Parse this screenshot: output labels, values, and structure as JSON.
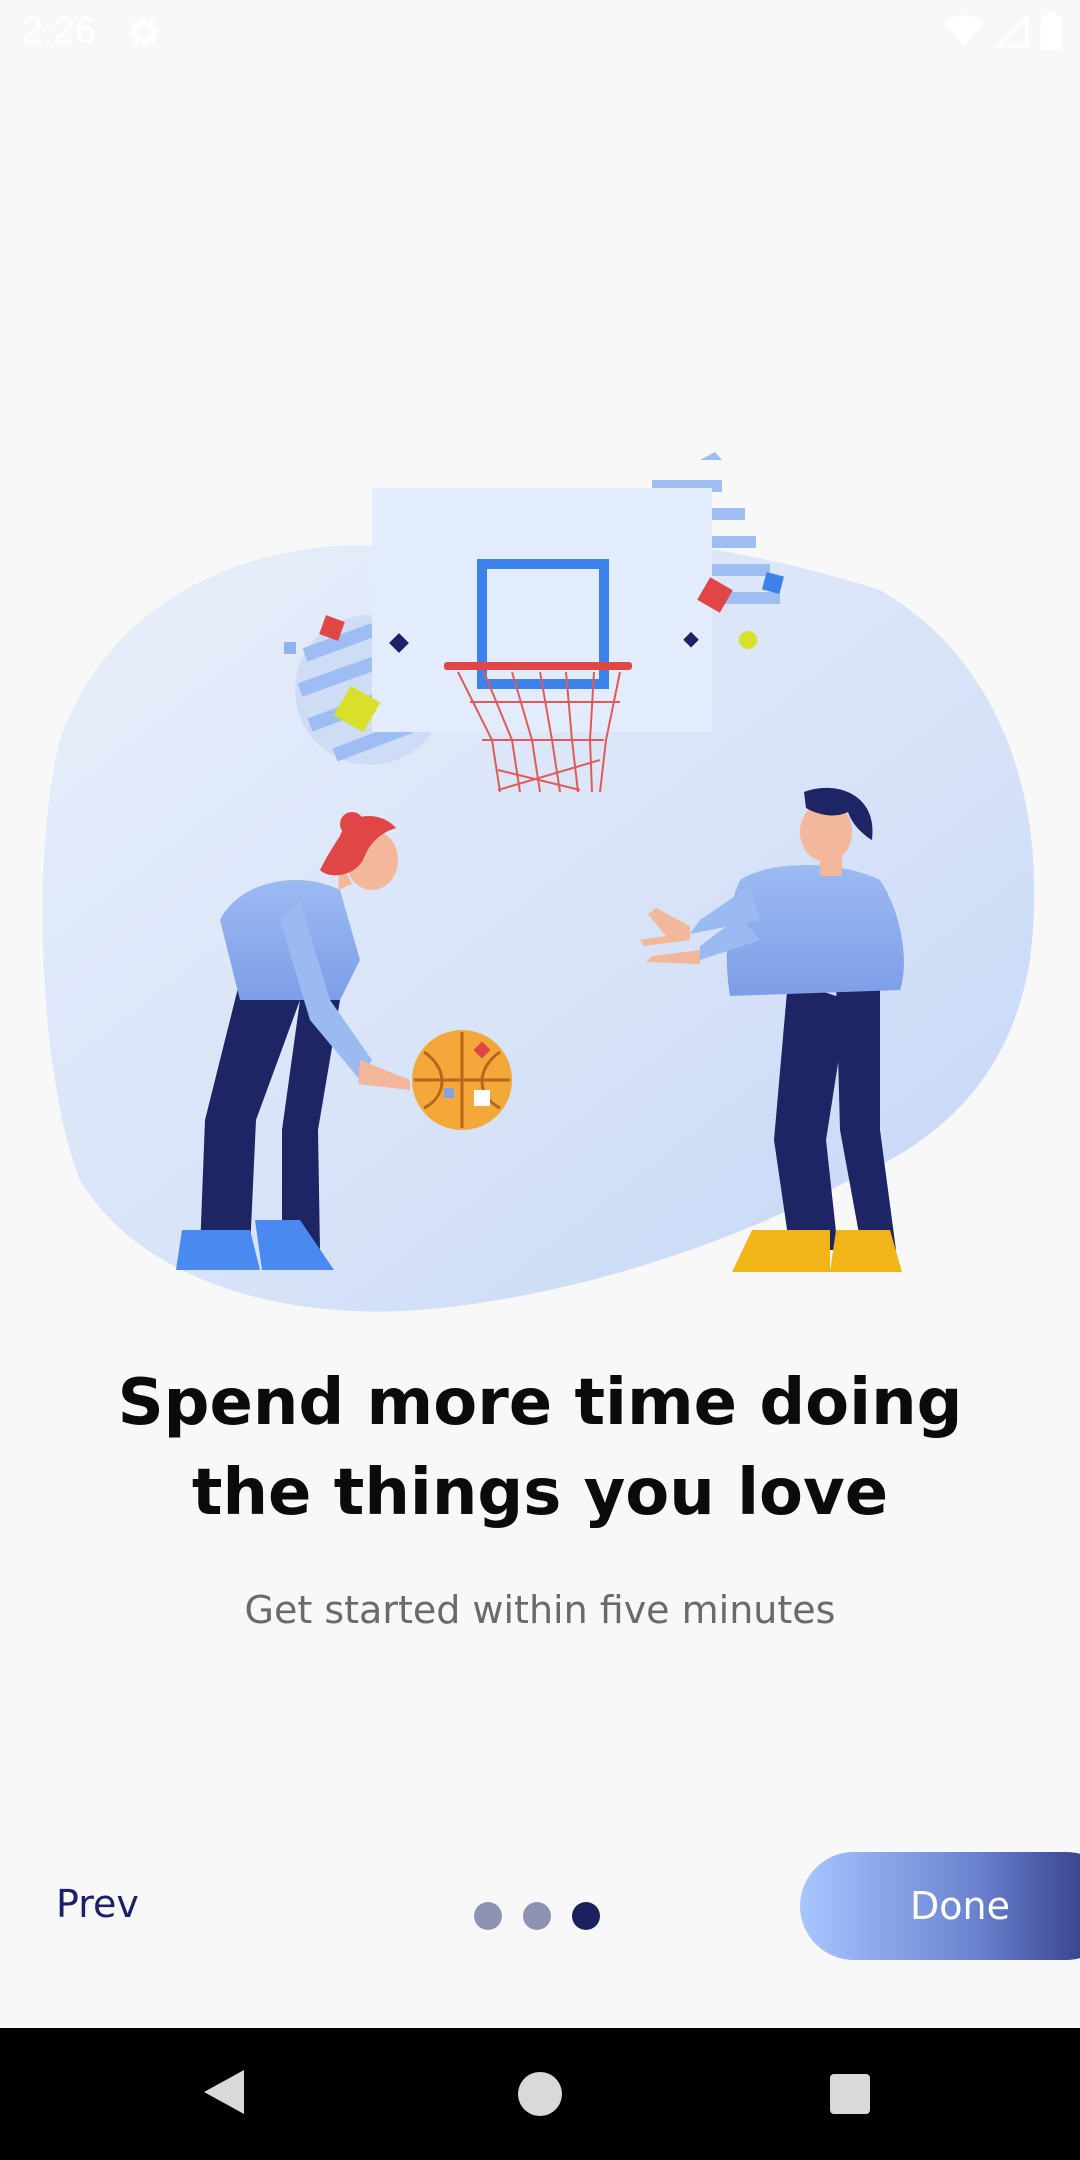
{
  "status_bar": {
    "time": "2:26",
    "icons": [
      "gear-icon",
      "wifi-icon",
      "signal-icon",
      "battery-icon"
    ]
  },
  "onboarding": {
    "title": "Spend more time doing the things you love",
    "subtitle": "Get started within five minutes",
    "illustration": "basketball-players-illustration"
  },
  "navigation": {
    "prev_label": "Prev",
    "done_label": "Done",
    "page_count": 3,
    "current_page": 3
  },
  "system_nav": {
    "icons": [
      "back-icon",
      "home-icon",
      "recents-icon"
    ]
  },
  "colors": {
    "background": "#f8f8f8",
    "headline": "#0b0b0b",
    "subtitle": "#6a6a6a",
    "prev_text": "#1c2167",
    "dot_inactive": "#8f92b3",
    "dot_active": "#1b205e",
    "done_gradient_start": "#a8c7ff",
    "done_gradient_end": "#2a2f7a"
  }
}
